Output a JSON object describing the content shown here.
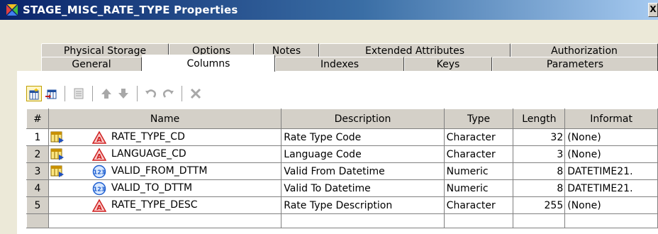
{
  "window": {
    "title": "STAGE_MISC_RATE_TYPE Properties",
    "close_label": "X"
  },
  "tabs_back": [
    {
      "label": "Physical Storage"
    },
    {
      "label": "Options"
    },
    {
      "label": "Notes"
    },
    {
      "label": "Extended Attributes"
    },
    {
      "label": "Authorization"
    }
  ],
  "tabs_front": [
    {
      "label": "General"
    },
    {
      "label": "Columns",
      "selected": true
    },
    {
      "label": "Indexes"
    },
    {
      "label": "Keys"
    },
    {
      "label": "Parameters"
    }
  ],
  "toolbar": [
    {
      "icon": "new-column-icon",
      "enabled": true,
      "active": true
    },
    {
      "icon": "import-column-icon",
      "enabled": true
    },
    {
      "icon": "properties-icon",
      "enabled": false
    },
    {
      "icon": "move-up-icon",
      "enabled": false
    },
    {
      "icon": "move-down-icon",
      "enabled": false
    },
    {
      "icon": "undo-icon",
      "enabled": false
    },
    {
      "icon": "redo-icon",
      "enabled": false
    },
    {
      "icon": "delete-icon",
      "enabled": false
    }
  ],
  "grid": {
    "headers": [
      "#",
      "Name",
      "Description",
      "Type",
      "Length",
      "Informat"
    ],
    "rows": [
      {
        "n": "1",
        "key": true,
        "icon": "character-icon",
        "name": "RATE_TYPE_CD",
        "description": "Rate Type Code",
        "type": "Character",
        "length": "32",
        "informat": "(None)"
      },
      {
        "n": "2",
        "key": true,
        "icon": "character-icon",
        "name": "LANGUAGE_CD",
        "description": "Language Code",
        "type": "Character",
        "length": "3",
        "informat": "(None)"
      },
      {
        "n": "3",
        "key": true,
        "icon": "numeric-icon",
        "name": "VALID_FROM_DTTM",
        "description": "Valid From Datetime",
        "type": "Numeric",
        "length": "8",
        "informat": "DATETIME21."
      },
      {
        "n": "4",
        "key": false,
        "icon": "numeric-icon",
        "name": "VALID_TO_DTTM",
        "description": "Valid To Datetime",
        "type": "Numeric",
        "length": "8",
        "informat": "DATETIME21."
      },
      {
        "n": "5",
        "key": false,
        "icon": "character-icon",
        "name": "RATE_TYPE_DESC",
        "description": "Rate Type Description",
        "type": "Character",
        "length": "255",
        "informat": "(None)"
      }
    ]
  }
}
